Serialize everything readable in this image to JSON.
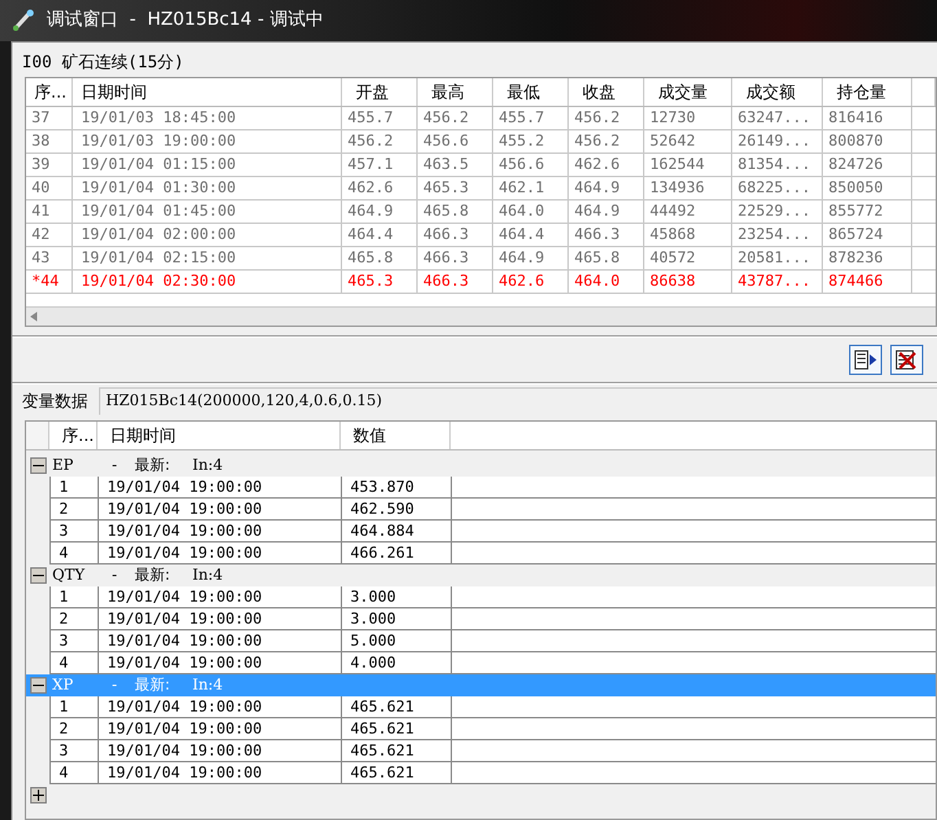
{
  "window": {
    "title": "调试窗口  -  HZ015Bc14 - 调试中"
  },
  "price_table": {
    "title": "I00 矿石连续(15分)",
    "columns": [
      "序...",
      "日期时间",
      "开盘",
      "最高",
      "最低",
      "收盘",
      "成交量",
      "成交额",
      "持仓量"
    ],
    "rows": [
      {
        "cells": [
          "37",
          "19/01/03 18:45:00",
          "455.7",
          "456.2",
          "455.7",
          "456.2",
          "12730",
          "63247...",
          "816416"
        ],
        "current": false
      },
      {
        "cells": [
          "38",
          "19/01/03 19:00:00",
          "456.2",
          "456.6",
          "455.2",
          "456.2",
          "52642",
          "26149...",
          "800870"
        ],
        "current": false
      },
      {
        "cells": [
          "39",
          "19/01/04 01:15:00",
          "457.1",
          "463.5",
          "456.6",
          "462.6",
          "162544",
          "81354...",
          "824726"
        ],
        "current": false
      },
      {
        "cells": [
          "40",
          "19/01/04 01:30:00",
          "462.6",
          "465.3",
          "462.1",
          "464.9",
          "134936",
          "68225...",
          "850050"
        ],
        "current": false
      },
      {
        "cells": [
          "41",
          "19/01/04 01:45:00",
          "464.9",
          "465.8",
          "464.0",
          "464.9",
          "44492",
          "22529...",
          "855772"
        ],
        "current": false
      },
      {
        "cells": [
          "42",
          "19/01/04 02:00:00",
          "464.4",
          "466.3",
          "464.4",
          "466.3",
          "45868",
          "23254...",
          "865724"
        ],
        "current": false
      },
      {
        "cells": [
          "43",
          "19/01/04 02:15:00",
          "465.8",
          "466.3",
          "464.9",
          "465.8",
          "40572",
          "20581...",
          "878236"
        ],
        "current": false
      },
      {
        "cells": [
          "*44",
          "19/01/04 02:30:00",
          "465.3",
          "466.3",
          "462.6",
          "464.0",
          "86638",
          "43787...",
          "874466"
        ],
        "current": true
      }
    ]
  },
  "variables": {
    "label": "变量数据",
    "signature": "HZ015Bc14(200000,120,4,0.6,0.15)",
    "columns": [
      "序...",
      "日期时间",
      "数值"
    ],
    "groups": [
      {
        "name": "EP",
        "separator": "-",
        "latest_label": "最新:",
        "index": "In:4",
        "expanded": true,
        "selected": false,
        "rows": [
          [
            "1",
            "19/01/04 19:00:00",
            "453.870"
          ],
          [
            "2",
            "19/01/04 19:00:00",
            "462.590"
          ],
          [
            "3",
            "19/01/04 19:00:00",
            "464.884"
          ],
          [
            "4",
            "19/01/04 19:00:00",
            "466.261"
          ]
        ]
      },
      {
        "name": "QTY",
        "separator": "-",
        "latest_label": "最新:",
        "index": "In:4",
        "expanded": true,
        "selected": false,
        "rows": [
          [
            "1",
            "19/01/04 19:00:00",
            "3.000"
          ],
          [
            "2",
            "19/01/04 19:00:00",
            "3.000"
          ],
          [
            "3",
            "19/01/04 19:00:00",
            "5.000"
          ],
          [
            "4",
            "19/01/04 19:00:00",
            "4.000"
          ]
        ]
      },
      {
        "name": "XP",
        "separator": "-",
        "latest_label": "最新:",
        "index": "In:4",
        "expanded": true,
        "selected": true,
        "rows": [
          [
            "1",
            "19/01/04 19:00:00",
            "465.621"
          ],
          [
            "2",
            "19/01/04 19:00:00",
            "465.621"
          ],
          [
            "3",
            "19/01/04 19:00:00",
            "465.621"
          ],
          [
            "4",
            "19/01/04 19:00:00",
            "465.621"
          ]
        ]
      }
    ],
    "trailing_toggle": {
      "expanded": false
    }
  }
}
